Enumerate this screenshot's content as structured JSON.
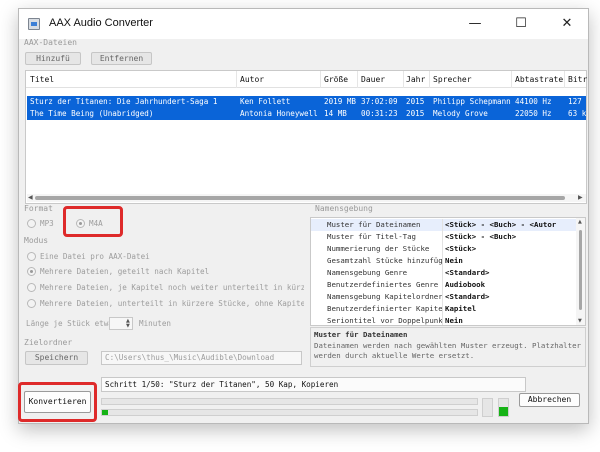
{
  "window": {
    "title": "AAX Audio Converter",
    "minimize": "—",
    "maximize": "☐",
    "close": "✕"
  },
  "aax_files": {
    "group_label": "AAX-Dateien",
    "add_button": "Hinzufü",
    "remove_button": "Entfernen",
    "columns": [
      "Titel",
      "Autor",
      "Größe",
      "Dauer",
      "Jahr",
      "Sprecher",
      "Abtastrate",
      "Bitr"
    ],
    "rows": [
      [
        "Sturz der Titanen: Die Jahrhundert-Saga 1",
        "Ken Follett",
        "2019 MB",
        "37:02:09",
        "2015",
        "Philipp Schepmann",
        "44100 Hz",
        "127"
      ],
      [
        "The Time Being (Unabridged)",
        "Antonia Honeywell",
        "14 MB",
        "00:31:23",
        "2015",
        "Melody Grove",
        "22050 Hz",
        "63 k"
      ]
    ]
  },
  "format": {
    "group_label": "Format",
    "mp3": "MP3",
    "m4a": "M4A",
    "selected": "M4A"
  },
  "mode": {
    "group_label": "Modus",
    "options": [
      "Eine Datei pro AAX-Datei",
      "Mehrere Dateien, geteilt nach Kapitel",
      "Mehrere Dateien, je Kapitel noch weiter unterteilt in kürzere",
      "Mehrere Dateien, unterteilt in kürzere Stücke, ohne Kapitel"
    ],
    "selected_index": 1,
    "length_label": "Länge je Stück etwa",
    "length_value": "",
    "length_unit": "Minuten"
  },
  "output": {
    "group_label": "Zielordner",
    "save_button": "Speichern",
    "path": "C:\\Users\\thus_\\Music\\Audible\\Download"
  },
  "naming": {
    "group_label": "Namensgebung",
    "properties": [
      {
        "name": "Muster für Dateinamen",
        "value": "<Stück> - <Buch> - <Autor"
      },
      {
        "name": "Muster für Titel-Tag",
        "value": "<Stück> - <Buch>"
      },
      {
        "name": "Nummerierung der Stücke",
        "value": "<Stück>"
      },
      {
        "name": "Gesamtzahl Stücke hinzufüg",
        "value": "Nein"
      },
      {
        "name": "Namensgebung Genre",
        "value": "<Standard>"
      },
      {
        "name": "Benutzerdefiniertes Genre",
        "value": "Audiobook"
      },
      {
        "name": "Namensgebung Kapitelordner",
        "value": "<Standard>"
      },
      {
        "name": "Benutzerdefinierter Kapite",
        "value": "Kapitel"
      },
      {
        "name": "Seriontitel vor Doppelpunkt",
        "value": "Nein"
      }
    ],
    "help_title": "Muster für Dateinamen",
    "help_text": "Dateinamen werden nach gewählten Muster erzeugt. Platzhalter werden durch aktuelle Werte ersetzt."
  },
  "convert": {
    "convert_button": "Konvertieren",
    "status": "Schritt 1/50: \"Sturz der Titanen\", 50 Kap, Kopieren",
    "overall_progress": 0.0,
    "file_progress": 0.01,
    "abort_button": "Abbrechen"
  },
  "colors": {
    "selection": "#0a64d8",
    "highlight": "#de2a2a",
    "progress": "#16b316"
  }
}
